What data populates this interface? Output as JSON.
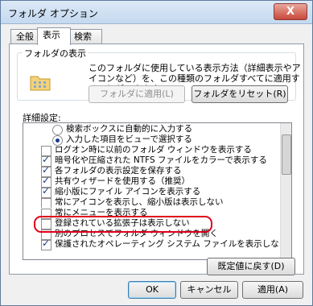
{
  "window": {
    "title": "フォルダ オプション",
    "close": "X"
  },
  "tabs": [
    {
      "label": "全般"
    },
    {
      "label": "表示"
    },
    {
      "label": "検索"
    }
  ],
  "folder_view": {
    "group_title": "フォルダの表示",
    "description": "このフォルダに使用している表示方法（詳細表示やアイコンなど）を、この種類のフォルダすべてに適用することができます。",
    "apply_button": "フォルダに適用(L)",
    "reset_button": "フォルダをリセット(R)"
  },
  "advanced": {
    "label": "詳細設定:",
    "items": [
      {
        "type": "radio",
        "checked": false,
        "text": "検索ボックスに自動的に入力する"
      },
      {
        "type": "radio",
        "checked": true,
        "text": "入力した項目をビューで選択する"
      },
      {
        "type": "checkbox",
        "checked": false,
        "text": "ログオン時に以前のフォルダ ウィンドウを表示する"
      },
      {
        "type": "checkbox",
        "checked": true,
        "text": "暗号化や圧縮された NTFS ファイルをカラーで表示する"
      },
      {
        "type": "checkbox",
        "checked": true,
        "text": "各フォルダの表示設定を保存する"
      },
      {
        "type": "checkbox",
        "checked": true,
        "text": "共有ウィザードを使用する（推奨）"
      },
      {
        "type": "checkbox",
        "checked": true,
        "text": "縮小版にファイル アイコンを表示する"
      },
      {
        "type": "checkbox",
        "checked": false,
        "text": "常にアイコンを表示し、縮小版は表示しない"
      },
      {
        "type": "checkbox",
        "checked": false,
        "text": "常にメニューを表示する"
      },
      {
        "type": "checkbox",
        "checked": false,
        "text": "登録されている拡張子は表示しない"
      },
      {
        "type": "checkbox",
        "checked": false,
        "text": "別のプロセスでフォルダ ウィンドウを開く"
      },
      {
        "type": "checkbox",
        "checked": true,
        "text": "保護されたオペレーティング システム ファイルを表示しない（推奨）"
      }
    ],
    "restore_button": "既定値に戻す(D)"
  },
  "footer": {
    "ok": "OK",
    "cancel": "キャンセル",
    "apply": "適用(A)"
  },
  "colors": {
    "highlight": "#e0001a",
    "accent": "#3c7fb1"
  }
}
